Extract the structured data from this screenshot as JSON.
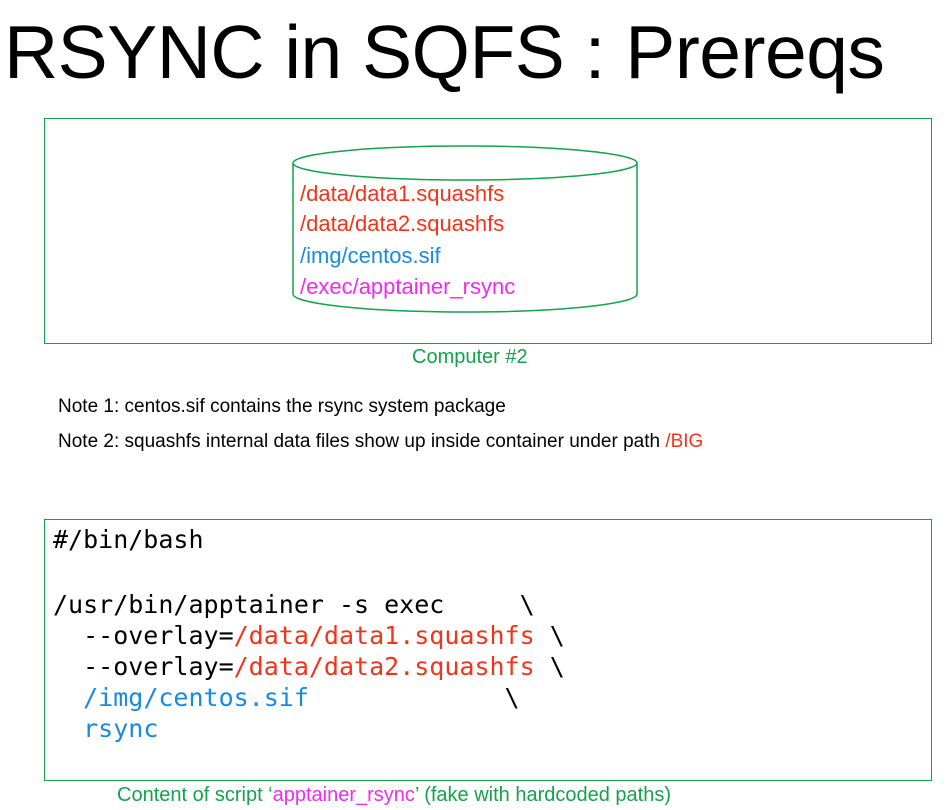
{
  "title": "RSYNC in SQFS : Prereqs",
  "computer": {
    "label": "Computer #2",
    "files": [
      {
        "path": "/data/data1.squashfs",
        "color": "#f2351a"
      },
      {
        "path": "/data/data2.squashfs",
        "color": "#f2351a"
      },
      {
        "path": "/img/centos.sif",
        "color": "#1a8ae0"
      },
      {
        "path": "/exec/apptainer_rsync",
        "color": "#ee2cf0"
      }
    ]
  },
  "notes": {
    "note1": "Note 1: centos.sif contains the rsync system package",
    "note2_prefix": "Note 2: squashfs internal data files show up inside container under path ",
    "note2_path": "/BIG"
  },
  "script": {
    "shebang": "#/bin/bash",
    "cmd": "/usr/bin/apptainer -s exec     \\",
    "overlay_flag": "  --overlay=",
    "overlay1_path": "/data/data1.squashfs",
    "overlay2_path": "/data/data2.squashfs",
    "cont1": " \\",
    "indent": "  ",
    "image_path": "/img/centos.sif",
    "image_cont": "             \\",
    "rsync": "rsync",
    "caption_prefix": "Content of script ‘",
    "caption_name": "apptainer_rsync",
    "caption_suffix": "’ (fake with hardcoded paths)"
  },
  "colors": {
    "border": "#13a34a",
    "data_path": "#f2351a",
    "image_path": "#1a8ae0",
    "exec_path": "#ee2cf0"
  }
}
